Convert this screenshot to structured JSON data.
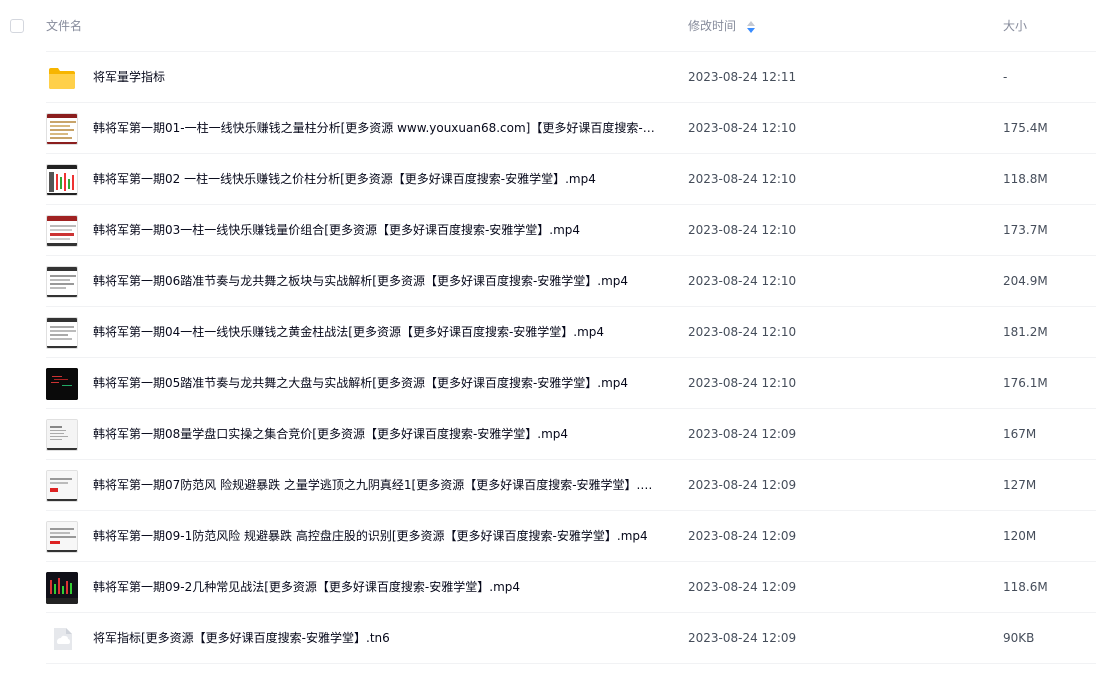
{
  "header": {
    "col_name": "文件名",
    "col_time": "修改时间",
    "col_size": "大小"
  },
  "files": [
    {
      "name": "将军量学指标",
      "time": "2023-08-24 12:11",
      "size": "-",
      "icon": "folder-icon"
    },
    {
      "name": "韩将军第一期01-一柱一线快乐赚钱之量柱分析[更多资源 www.youxuan68.com]【更多好课百度搜索-安...",
      "time": "2023-08-24 12:10",
      "size": "175.4M",
      "icon": "video-thumbnail-icon"
    },
    {
      "name": "韩将军第一期02 一柱一线快乐赚钱之价柱分析[更多资源【更多好课百度搜索-安雅学堂】.mp4",
      "time": "2023-08-24 12:10",
      "size": "118.8M",
      "icon": "video-thumbnail-icon"
    },
    {
      "name": "韩将军第一期03一柱一线快乐赚钱量价组合[更多资源【更多好课百度搜索-安雅学堂】.mp4",
      "time": "2023-08-24 12:10",
      "size": "173.7M",
      "icon": "video-thumbnail-icon"
    },
    {
      "name": "韩将军第一期06踏准节奏与龙共舞之板块与实战解析[更多资源【更多好课百度搜索-安雅学堂】.mp4",
      "time": "2023-08-24 12:10",
      "size": "204.9M",
      "icon": "video-thumbnail-icon"
    },
    {
      "name": "韩将军第一期04一柱一线快乐赚钱之黄金柱战法[更多资源【更多好课百度搜索-安雅学堂】.mp4",
      "time": "2023-08-24 12:10",
      "size": "181.2M",
      "icon": "video-thumbnail-icon"
    },
    {
      "name": "韩将军第一期05踏准节奏与龙共舞之大盘与实战解析[更多资源【更多好课百度搜索-安雅学堂】.mp4",
      "time": "2023-08-24 12:10",
      "size": "176.1M",
      "icon": "video-thumbnail-icon"
    },
    {
      "name": "韩将军第一期08量学盘口实操之集合竞价[更多资源【更多好课百度搜索-安雅学堂】.mp4",
      "time": "2023-08-24 12:09",
      "size": "167M",
      "icon": "video-thumbnail-icon"
    },
    {
      "name": "韩将军第一期07防范风 险规避暴跌 之量学逃顶之九阴真经1[更多资源【更多好课百度搜索-安雅学堂】.mp4",
      "time": "2023-08-24 12:09",
      "size": "127M",
      "icon": "video-thumbnail-icon"
    },
    {
      "name": "韩将军第一期09-1防范风险 规避暴跌 高控盘庄股的识别[更多资源【更多好课百度搜索-安雅学堂】.mp4",
      "time": "2023-08-24 12:09",
      "size": "120M",
      "icon": "video-thumbnail-icon"
    },
    {
      "name": "韩将军第一期09-2几种常见战法[更多资源【更多好课百度搜索-安雅学堂】.mp4",
      "time": "2023-08-24 12:09",
      "size": "118.6M",
      "icon": "video-thumbnail-icon"
    },
    {
      "name": "将军指标[更多资源【更多好课百度搜索-安雅学堂】.tn6",
      "time": "2023-08-24 12:09",
      "size": "90KB",
      "icon": "unknown-file-icon"
    }
  ]
}
